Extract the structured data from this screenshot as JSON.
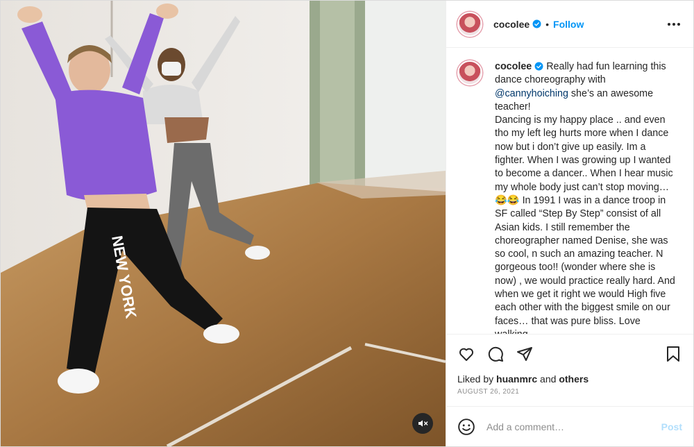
{
  "post": {
    "username": "cocolee",
    "separator": "•",
    "follow_label": "Follow",
    "more_icon": "more-horizontal-icon",
    "verified_color": "#0095f6"
  },
  "caption": {
    "username": "cocolee",
    "intro": "Really had fun learning this dance choreography with",
    "mention": "@cannyhoiching",
    "body_1": " she’s an awesome teacher!\nDancing is my happy place .. and even tho my left leg hurts more when I dance now but i don’t give up easily. Im a fighter. When I was growing up I wanted to become a dancer.. When I hear music my whole body just can’t stop moving… ",
    "emoji": "😂😂",
    "body_2": " In 1991 I was in a dance troop in SF called “Step By Step” consist of all Asian kids. I still remember the choreographer named Denise, she was so cool, n such an amazing teacher. N gorgeous too!! (wonder where she is now) , we would practice really hard. And when we get it right we would High five each other with the biggest smile on our faces… that was pure bliss. Love walking"
  },
  "actions": {
    "like_icon": "heart-icon",
    "comment_icon": "comment-icon",
    "share_icon": "share-icon",
    "save_icon": "bookmark-icon"
  },
  "likes": {
    "prefix": "Liked by ",
    "user": "huanmrc",
    "middle": " and ",
    "others": "others"
  },
  "date": "AUGUST 26, 2021",
  "comment": {
    "placeholder": "Add a comment…",
    "post_label": "Post",
    "emoji_icon": "smiley-icon"
  },
  "media": {
    "mute_icon": "speaker-muted-icon",
    "overlay_text": "NEW YORK"
  },
  "colors": {
    "link": "#0095f6",
    "mention": "#00376b",
    "muted_text": "#8e8e8e",
    "post_disabled": "#b2dffc",
    "hoodie": "#8a5ad6",
    "floor": "#a77a45"
  }
}
